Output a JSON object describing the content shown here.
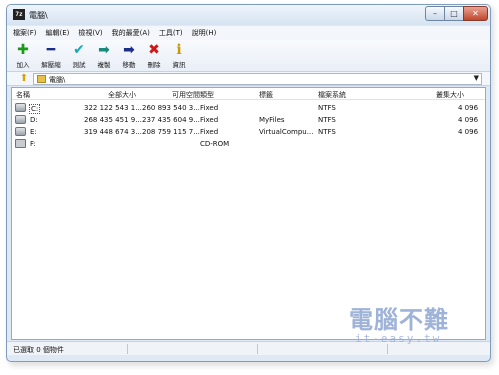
{
  "window": {
    "app_icon_text": "7z",
    "title": "電腦\\",
    "controls": {
      "minimize": "–",
      "maximize": "□",
      "close": "✕"
    }
  },
  "menu": [
    "檔案(F)",
    "編輯(E)",
    "檢視(V)",
    "我的最愛(A)",
    "工具(T)",
    "說明(H)"
  ],
  "toolbar": [
    {
      "label": "加入",
      "icon": "plus-icon",
      "glyph": "✚",
      "color": "#1a9a1a"
    },
    {
      "label": "解壓縮",
      "icon": "minus-icon",
      "glyph": "━",
      "color": "#1a2f8a"
    },
    {
      "label": "測試",
      "icon": "check-icon",
      "glyph": "✔",
      "color": "#1aa7b5"
    },
    {
      "label": "複製",
      "icon": "copy-arrow-icon",
      "glyph": "➡",
      "color": "#1a8a7a"
    },
    {
      "label": "移動",
      "icon": "move-arrow-icon",
      "glyph": "➡",
      "color": "#1a2f8a"
    },
    {
      "label": "刪除",
      "icon": "delete-x-icon",
      "glyph": "✖",
      "color": "#cc1a1a"
    },
    {
      "label": "資訊",
      "icon": "info-icon",
      "glyph": "i",
      "color": "#c89a00"
    }
  ],
  "address": {
    "path": "電腦\\",
    "dropdown": "▼"
  },
  "list": {
    "columns": [
      "名稱",
      "全部大小",
      "可用空間",
      "類型",
      "標籤",
      "檔案系統",
      "叢集大小"
    ],
    "rows": [
      {
        "name": "C:",
        "total": "322 122 543 1...",
        "free": "260 893 540 3...",
        "type": "Fixed",
        "label": "",
        "fs": "NTFS",
        "cluster": "4 096",
        "icon": "system-drive-icon"
      },
      {
        "name": "D:",
        "total": "268 435 451 9...",
        "free": "237 435 604 9...",
        "type": "Fixed",
        "label": "MyFiles",
        "fs": "NTFS",
        "cluster": "4 096",
        "icon": "hard-drive-icon"
      },
      {
        "name": "E:",
        "total": "319 448 674 3...",
        "free": "208 759 115 7...",
        "type": "Fixed",
        "label": "VirtualCompu...",
        "fs": "NTFS",
        "cluster": "4 096",
        "icon": "hard-drive-icon"
      },
      {
        "name": "F:",
        "total": "",
        "free": "",
        "type": "CD-ROM",
        "label": "",
        "fs": "",
        "cluster": "",
        "icon": "cdrom-drive-icon"
      }
    ]
  },
  "status": {
    "text": "已選取 0 個物件"
  },
  "watermark": {
    "main": "電腦不難",
    "sub": "it-easy.tw"
  }
}
